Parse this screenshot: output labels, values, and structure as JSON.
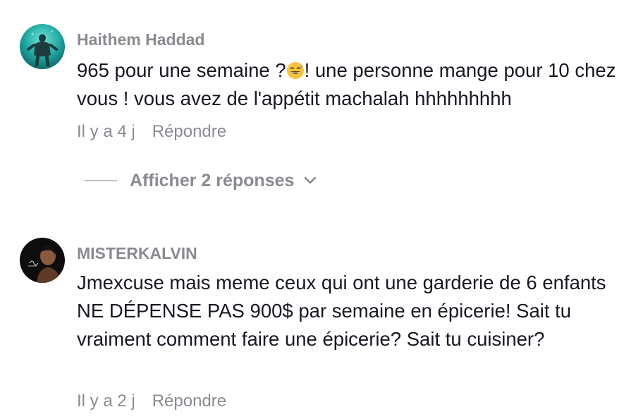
{
  "comments": [
    {
      "author": "Haithem Haddad",
      "text_before_emoji": "965 pour une semaine ?",
      "emoji": "grinning-sweat-emoji",
      "text_after_emoji": "! une personne mange pour 10 chez vous ! vous avez de l'appétit machalah hhhhhhhhh",
      "time": "Il y a 4 j",
      "reply_label": "Répondre",
      "show_replies_label": "Afficher 2 réponses"
    },
    {
      "author": "MISTERKALVIN",
      "text": "Jmexcuse mais meme ceux qui ont une garderie de 6 enfants NE DÉPENSE PAS 900$ par semaine en épicerie! Sait tu vraiment comment faire une épicerie? Sait tu cuisiner?",
      "time": "Il y a 2 j",
      "reply_label": "Répondre"
    }
  ],
  "colors": {
    "text": "#161823",
    "muted": "#8a8b91",
    "divider": "#bdbec2"
  }
}
